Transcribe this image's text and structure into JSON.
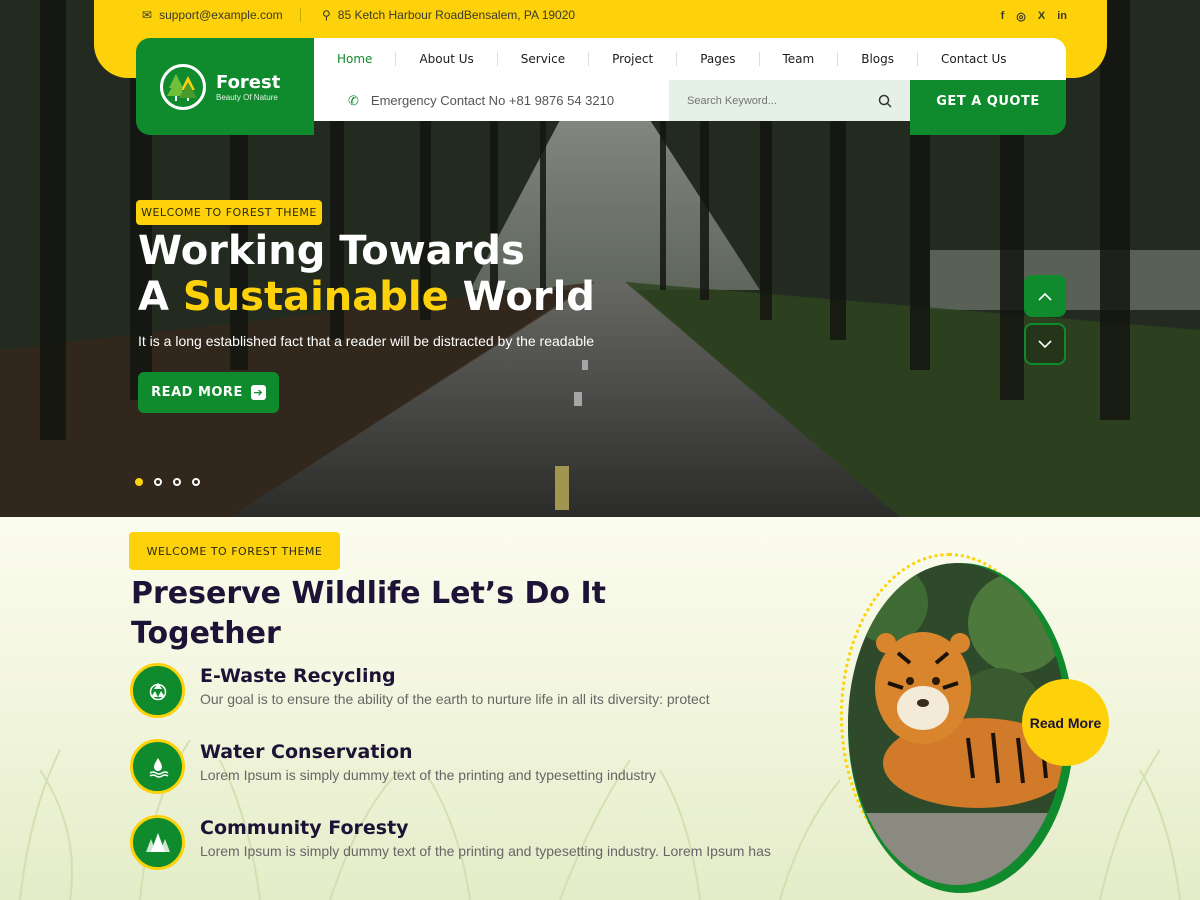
{
  "topbar": {
    "email": "support@example.com",
    "address": "85 Ketch Harbour RoadBensalem, PA 19020",
    "social": [
      {
        "icon": "facebook-icon",
        "glyph": "f"
      },
      {
        "icon": "instagram-icon",
        "glyph": "◎"
      },
      {
        "icon": "x-twitter-icon",
        "glyph": "X"
      },
      {
        "icon": "linkedin-icon",
        "glyph": "in"
      }
    ]
  },
  "brand": {
    "name": "Forest",
    "tagline": "Beauty Of Nature"
  },
  "nav": {
    "items": [
      "Home",
      "About Us",
      "Service",
      "Project",
      "Pages",
      "Team",
      "Blogs",
      "Contact Us"
    ],
    "active": "Home"
  },
  "contact": {
    "emergency": "Emergency Contact No +81 9876 54 3210"
  },
  "search": {
    "placeholder": "Search Keyword..."
  },
  "quote_label": "GET A QUOTE",
  "hero": {
    "badge": "WELCOME TO FOREST THEME",
    "title_line1": "Working Towards",
    "title_a": "A ",
    "title_highlight": "Sustainable",
    "title_end": " World",
    "subtitle": "It is a long established fact that a reader will be distracted by the readable",
    "cta": "READ MORE",
    "slides_total": 4,
    "slide_active": 1
  },
  "section": {
    "badge": "WELCOME TO FOREST THEME",
    "title": "Preserve Wildlife Let’s Do It Together",
    "features": [
      {
        "icon": "recycle-icon",
        "title": "E-Waste Recycling",
        "text": "Our goal is to ensure the ability of the earth to nurture life in all its diversity: protect"
      },
      {
        "icon": "water-drop-icon",
        "title": "Water Conservation",
        "text": "Lorem Ipsum is simply dummy text of the printing and typesetting industry"
      },
      {
        "icon": "trees-icon",
        "title": "Community Foresty",
        "text": "Lorem Ipsum is simply dummy text of the printing and typesetting industry. Lorem Ipsum has"
      }
    ],
    "read_more": "Read More"
  },
  "colors": {
    "green": "#0f8a2c",
    "yellow": "#fdd20a",
    "dark": "#1d1336"
  }
}
